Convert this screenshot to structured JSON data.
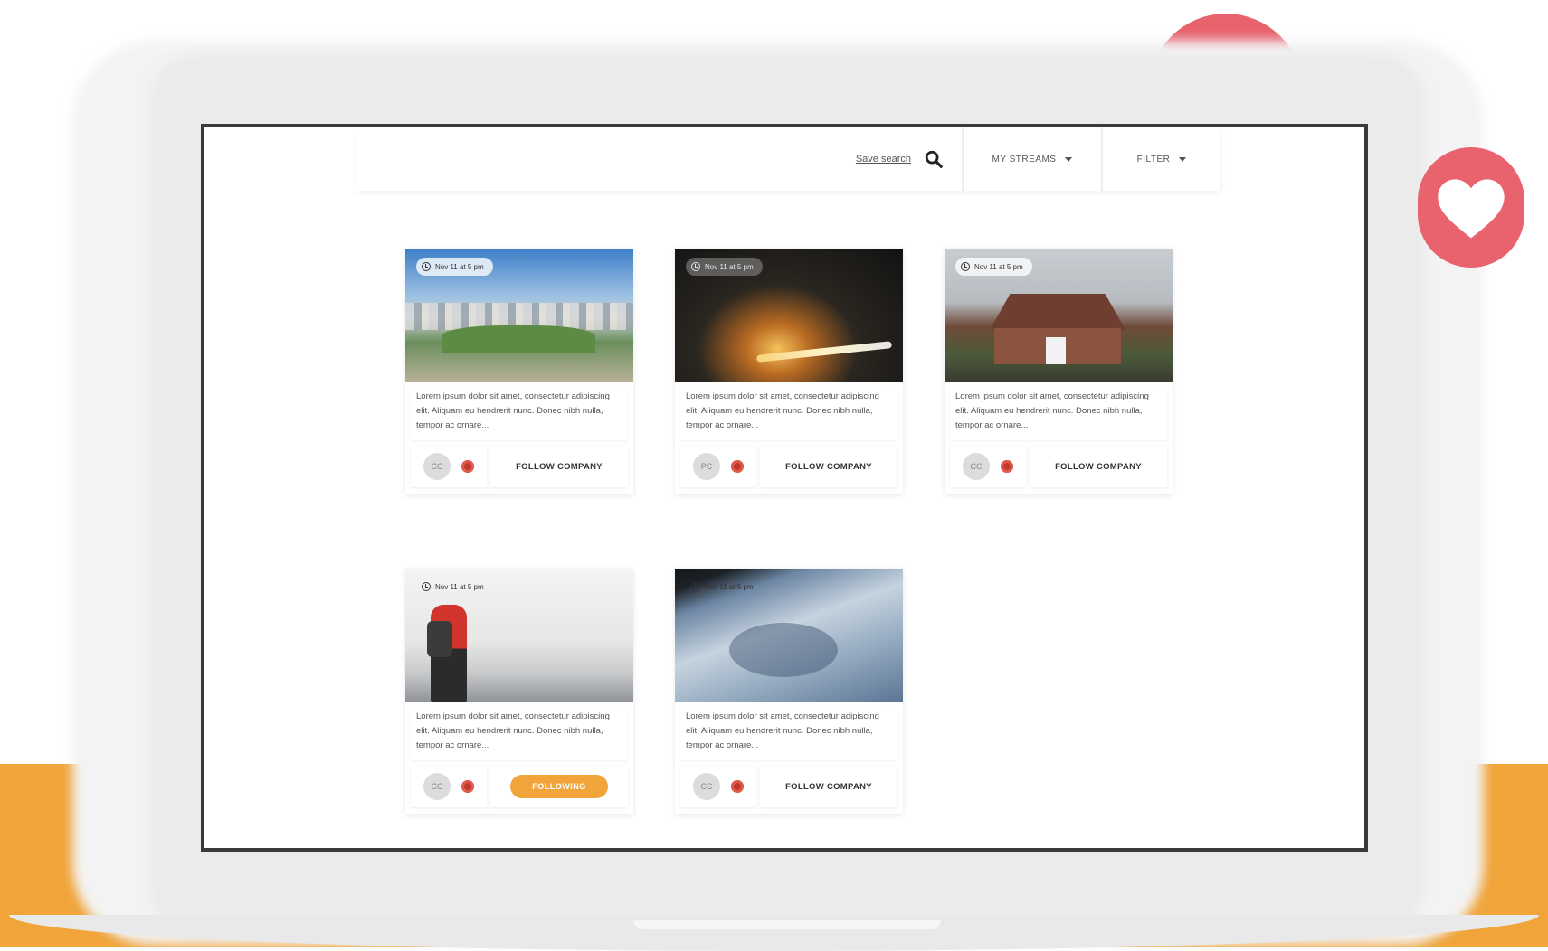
{
  "toolbar": {
    "save_search_label": "Save search",
    "streams_label": "MY STREAMS",
    "filter_label": "FILTER"
  },
  "cards": [
    {
      "timestamp": "Nov 11 at 5 pm",
      "image": "city-skyline",
      "text": "Lorem ipsum dolor sit amet, consectetur adipiscing elit. Aliquam eu hendrerit nunc. Donec nibh nulla, tempor ac ornare...",
      "avatar_initials": "CC",
      "action_label": "FOLLOW COMPANY",
      "following": false
    },
    {
      "timestamp": "Nov 11 at 5 pm",
      "image": "welder-sparks",
      "text": "Lorem ipsum dolor sit amet, consectetur adipiscing elit. Aliquam eu hendrerit nunc. Donec nibh nulla, tempor ac ornare...",
      "avatar_initials": "PC",
      "action_label": "FOLLOW COMPANY",
      "following": false
    },
    {
      "timestamp": "Nov 11 at 5 pm",
      "image": "brick-house",
      "text": "Lorem ipsum dolor sit amet, consectetur adipiscing elit. Aliquam eu hendrerit nunc. Donec nibh nulla, tempor ac ornare...",
      "avatar_initials": "CC",
      "action_label": "FOLLOW COMPANY",
      "following": false
    },
    {
      "timestamp": "Nov 11 at 5 pm",
      "image": "hiker-city-view",
      "text": "Lorem ipsum dolor sit amet, consectetur adipiscing elit. Aliquam eu hendrerit nunc. Donec nibh nulla, tempor ac ornare...",
      "avatar_initials": "CC",
      "action_label": "FOLLOWING",
      "following": true
    },
    {
      "timestamp": "Nov 11 at 5 pm",
      "image": "earth-from-space",
      "text": "Lorem ipsum dolor sit amet, consectetur adipiscing elit. Aliquam eu hendrerit nunc. Donec nibh nulla, tempor ac ornare...",
      "avatar_initials": "CC",
      "action_label": "FOLLOW COMPANY",
      "following": false
    }
  ],
  "colors": {
    "accent_orange": "#f0a43a",
    "heart_red": "#e8636d",
    "logo_red": "#c0392b"
  },
  "icons": [
    "search-icon",
    "chevron-down-icon",
    "clock-icon",
    "heart-icon"
  ]
}
